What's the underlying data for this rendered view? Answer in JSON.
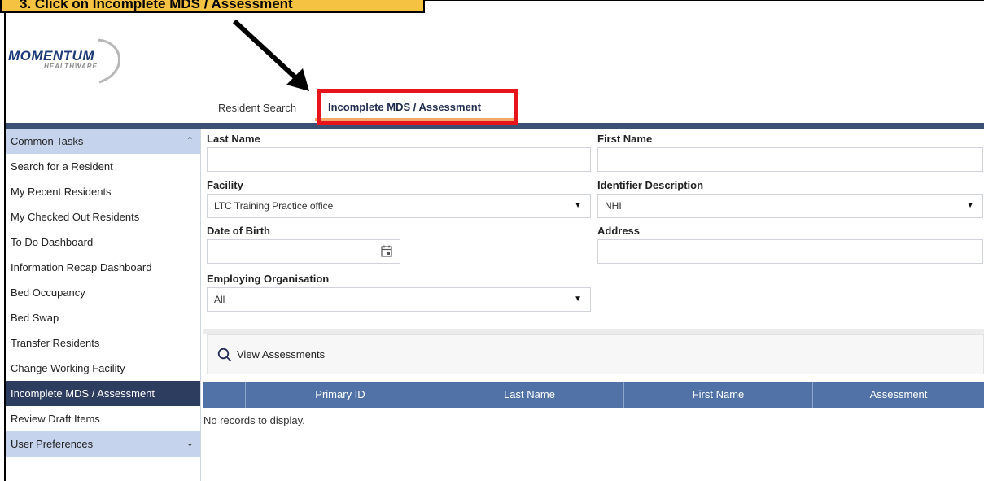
{
  "callout": {
    "text": "3. Click on Incomplete MDS / Assessment"
  },
  "logo": {
    "name": "MOMENTUM",
    "sub": "HEALTHWARE"
  },
  "tabs": [
    {
      "label": "Resident Search"
    },
    {
      "label": "Incomplete MDS / Assessment"
    }
  ],
  "sidebar": {
    "common_tasks": "Common Tasks",
    "items": [
      "Search for a Resident",
      "My Recent Residents",
      "My Checked Out Residents",
      "To Do Dashboard",
      "Information Recap Dashboard",
      "Bed Occupancy",
      "Bed Swap",
      "Transfer Residents",
      "Change Working Facility",
      "Incomplete MDS / Assessment",
      "Review Draft Items"
    ],
    "user_preferences": "User Preferences"
  },
  "form": {
    "last_name": {
      "label": "Last Name",
      "value": ""
    },
    "first_name": {
      "label": "First Name",
      "value": ""
    },
    "facility": {
      "label": "Facility",
      "value": "LTC Training Practice office"
    },
    "identifier": {
      "label": "Identifier Description",
      "value": "NHI"
    },
    "dob": {
      "label": "Date of Birth",
      "value": ""
    },
    "address": {
      "label": "Address",
      "value": ""
    },
    "employer": {
      "label": "Employing Organisation",
      "value": "All"
    }
  },
  "actions": {
    "view_assessments": "View Assessments"
  },
  "grid": {
    "columns": [
      "",
      "Primary ID",
      "Last Name",
      "First Name",
      "Assessment"
    ],
    "empty_text": "No records to display."
  },
  "colors": {
    "accent_bar": "#3b4e74",
    "grid_header": "#5072a6",
    "sidebar_header": "#c6d3ec",
    "sidebar_active": "#2d3d5f",
    "highlight": "#e8141b",
    "callout": "#f5c242",
    "tab_underline": "#f1a86a"
  }
}
